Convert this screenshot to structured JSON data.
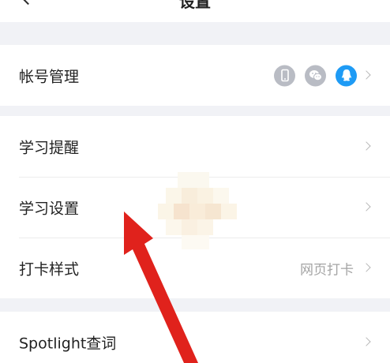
{
  "nav": {
    "title": "设置"
  },
  "account": {
    "label": "帐号管理",
    "bound_icons": [
      "phone-icon",
      "wechat-icon",
      "qq-icon"
    ]
  },
  "study": {
    "reminder_label": "学习提醒",
    "settings_label": "学习设置",
    "checkin_label": "打卡样式",
    "checkin_value": "网页打卡"
  },
  "lookup": {
    "spotlight_label": "Spotlight查词"
  },
  "colors": {
    "accent": "#1e9bf5",
    "annotation_arrow": "#e0221c",
    "background": "#f1f2f6"
  }
}
